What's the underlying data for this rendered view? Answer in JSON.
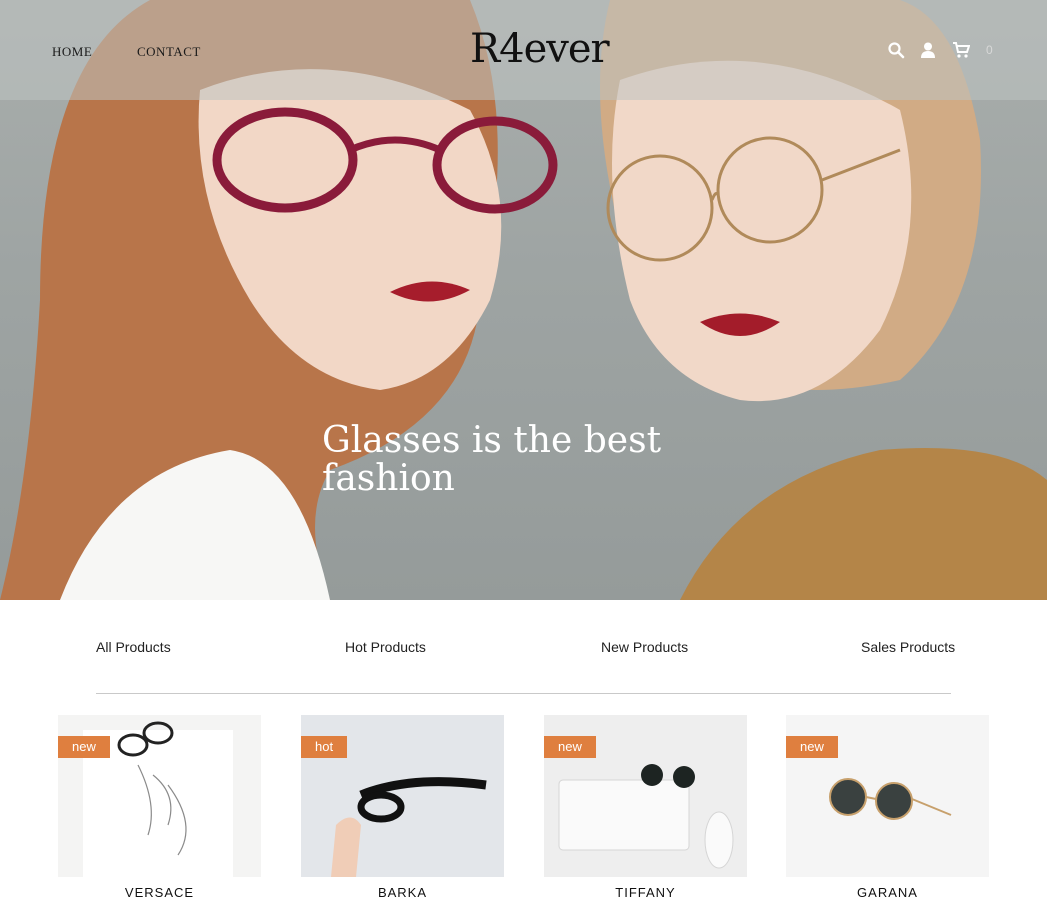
{
  "header": {
    "nav": [
      "HOME",
      "CONTACT"
    ],
    "logo": "R4ever",
    "cart_count": "0"
  },
  "hero": {
    "title": "Glasses is the best fashion"
  },
  "tabs": [
    "All Products",
    "Hot Products",
    "New Products",
    "Sales Products"
  ],
  "products": [
    {
      "badge": "new",
      "name": "VERSACE"
    },
    {
      "badge": "hot",
      "name": "BARKA"
    },
    {
      "badge": "new",
      "name": "TIFFANY"
    },
    {
      "badge": "new",
      "name": "GARANA"
    }
  ],
  "colors": {
    "badge": "#df7f3f",
    "cart_count": "#d8d8d8"
  },
  "icons": [
    "search-icon",
    "user-icon",
    "cart-icon"
  ]
}
